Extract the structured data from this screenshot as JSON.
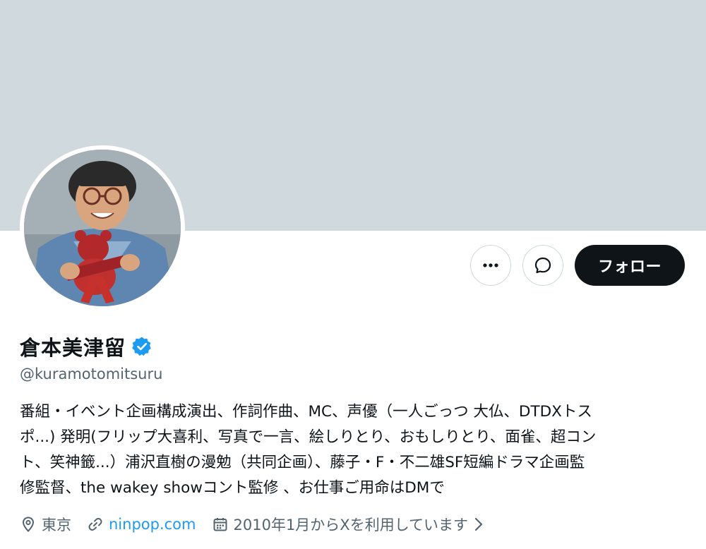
{
  "profile": {
    "display_name": "倉本美津留",
    "handle": "@kuramotomitsuru",
    "verified_icon": "verified-badge-icon",
    "bio_lines": [
      "番組・イベント企画構成演出、作詞作曲、MC、声優（一人ごっつ 大仏、DTDXトス",
      "ポ...) 発明(フリップ大喜利、写真で一言、絵しりとり、おもしりとり、面雀、超コン",
      "ト、笑神籤...）浦沢直樹の漫勉（共同企画）、藤子・F・不二雄SF短編ドラマ企画監",
      "修監督、the wakey showコント監修 、お仕事ご用命はDMで"
    ],
    "location": "東京",
    "website": "ninpop.com",
    "joined": "2010年1月からXを利用しています"
  },
  "actions": {
    "more_icon": "more-dots-icon",
    "message_icon": "message-icon",
    "follow_label": "フォロー"
  },
  "colors": {
    "banner": "#cfd9de",
    "accent": "#1d9bf0",
    "text_primary": "#0f1419",
    "text_secondary": "#536471",
    "follow_bg": "#0f1419"
  }
}
